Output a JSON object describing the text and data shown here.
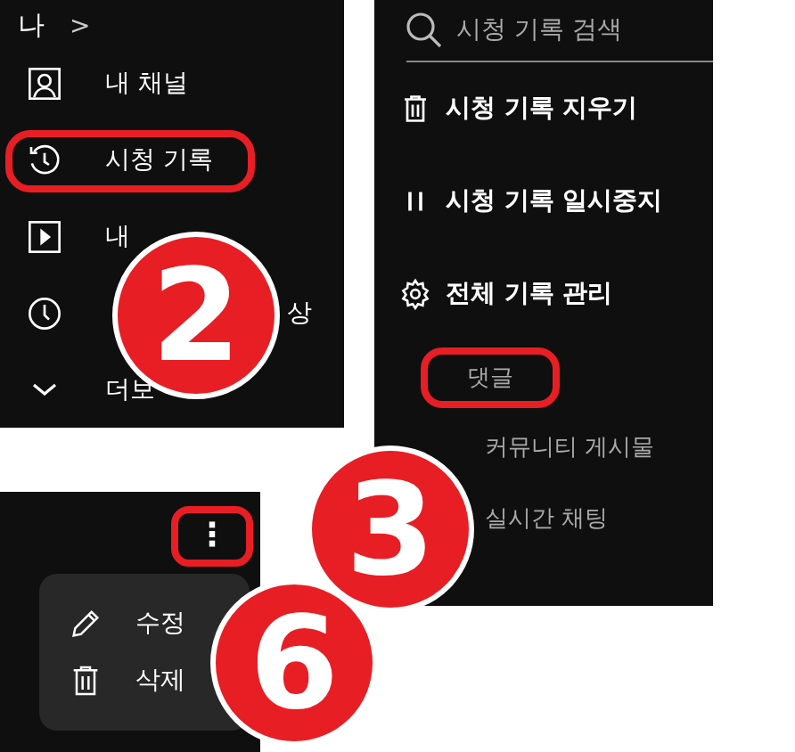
{
  "nav_panel": {
    "header": {
      "label": "나",
      "chevron": ">"
    },
    "items": [
      {
        "label": "내 채널",
        "highlighted": false
      },
      {
        "label": "시청 기록",
        "highlighted": true
      },
      {
        "label": "내",
        "highlighted": false
      },
      {
        "label": "상",
        "highlighted": false
      },
      {
        "label": "더보",
        "highlighted": false
      }
    ]
  },
  "history_panel": {
    "search": {
      "placeholder": "시청 기록 검색"
    },
    "actions": [
      {
        "label": "시청 기록 지우기"
      },
      {
        "label": "시청 기록 일시중지"
      },
      {
        "label": "전체 기록 관리"
      }
    ],
    "sub_items": [
      {
        "label": "댓글",
        "highlighted": true
      },
      {
        "label": "커뮤니티 게시물",
        "highlighted": false
      },
      {
        "label": "실시간 채팅",
        "highlighted": false
      }
    ]
  },
  "comment_panel": {
    "more_button": {
      "label": "⋮",
      "highlighted": true
    },
    "menu": [
      {
        "label": "수정"
      },
      {
        "label": "삭제"
      }
    ]
  },
  "callouts": [
    {
      "number": "2"
    },
    {
      "number": "3"
    },
    {
      "number": "6"
    }
  ]
}
